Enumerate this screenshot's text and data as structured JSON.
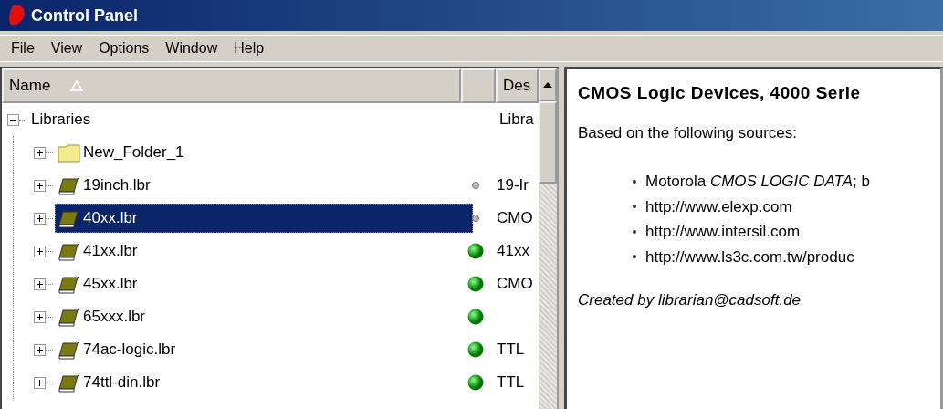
{
  "window": {
    "title": "Control Panel"
  },
  "menu": [
    "File",
    "View",
    "Options",
    "Window",
    "Help"
  ],
  "columns": [
    {
      "label": "Name",
      "sorted": true
    },
    {},
    {
      "label": "Des"
    }
  ],
  "tree": [
    {
      "label": "Libraries",
      "expanded": true,
      "description": "Libra",
      "children": [
        {
          "label": "New_Folder_1",
          "kind": "folder",
          "expanded": false,
          "selected": false
        },
        {
          "label": "19inch.lbr",
          "kind": "library",
          "expanded": false,
          "selected": false,
          "active": false,
          "description": "19-Ir"
        },
        {
          "label": "40xx.lbr",
          "kind": "library",
          "expanded": false,
          "selected": true,
          "active": false,
          "description": "CMO"
        },
        {
          "label": "41xx.lbr",
          "kind": "library",
          "expanded": false,
          "selected": false,
          "active": true,
          "description": "41xx"
        },
        {
          "label": "45xx.lbr",
          "kind": "library",
          "expanded": false,
          "selected": false,
          "active": true,
          "description": "CMO"
        },
        {
          "label": "65xxx.lbr",
          "kind": "library",
          "expanded": false,
          "selected": false,
          "active": true
        },
        {
          "label": "74ac-logic.lbr",
          "kind": "library",
          "expanded": false,
          "selected": false,
          "active": true,
          "description": "TTL"
        },
        {
          "label": "74ttl-din.lbr",
          "kind": "library",
          "expanded": false,
          "selected": false,
          "active": true,
          "description": "TTL"
        }
      ]
    }
  ],
  "details": {
    "heading": "CMOS Logic Devices, 4000 Serie",
    "intro": "Based on the following sources:",
    "sources": [
      "Motorola *CMOS LOGIC DATA*; b",
      "http://www.elexp.com",
      "http://www.intersil.com",
      "http://www.ls3c.com.tw/produc"
    ],
    "footer": "Created by librarian@cadsoft.de"
  }
}
